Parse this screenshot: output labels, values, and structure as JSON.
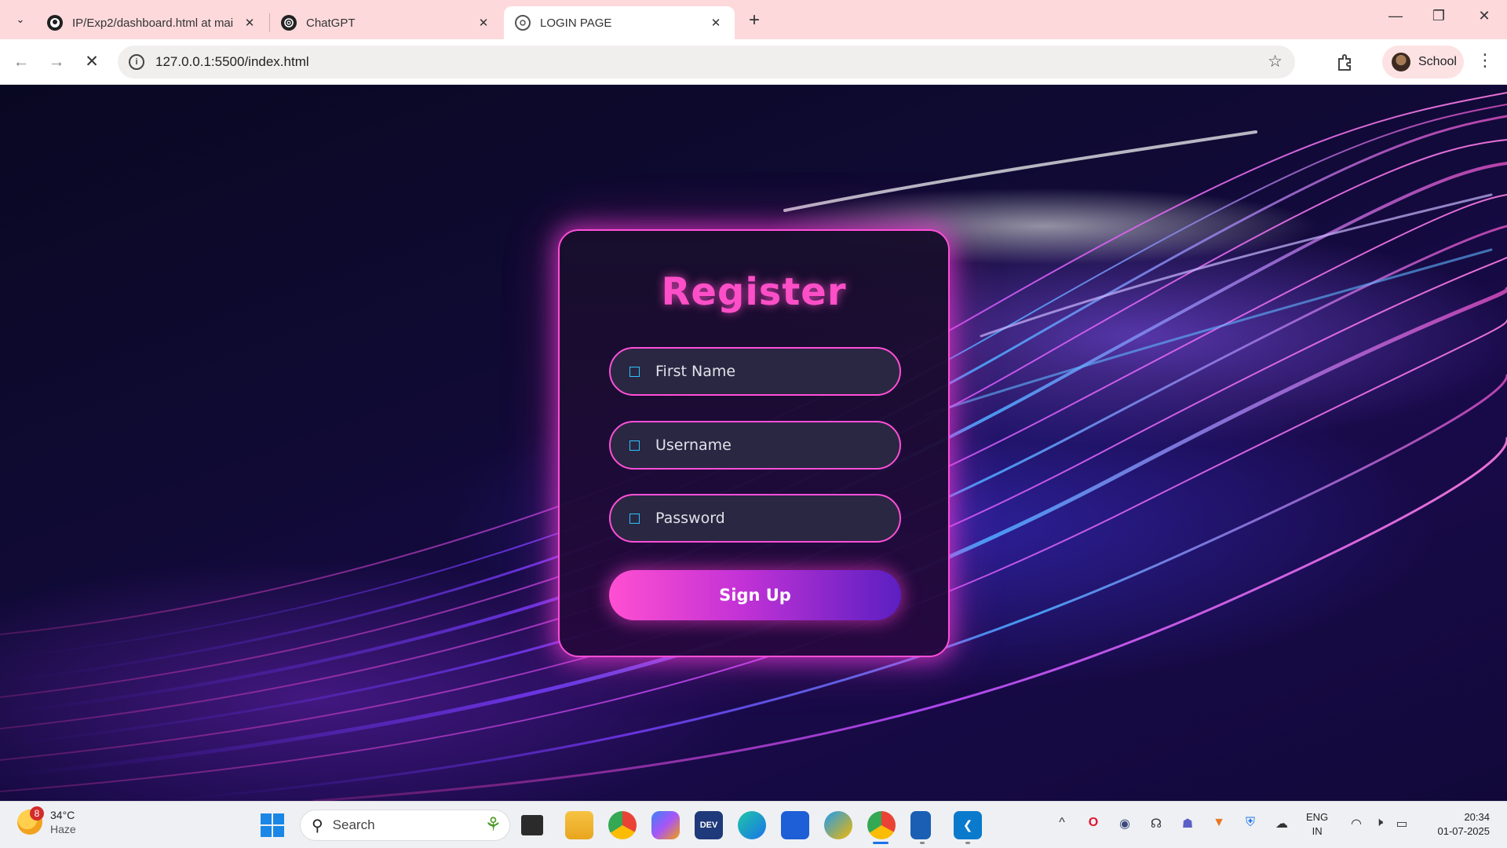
{
  "browser": {
    "tabs": [
      {
        "title": "IP/Exp2/dashboard.html at mai",
        "icon": "github-icon"
      },
      {
        "title": "ChatGPT",
        "icon": "chatgpt-icon"
      },
      {
        "title": "LOGIN PAGE",
        "icon": "page-favicon-icon",
        "active": true
      }
    ],
    "url": "127.0.0.1:5500/index.html",
    "profile_label": "School"
  },
  "form": {
    "title": "Register",
    "fields": [
      {
        "placeholder": "First Name"
      },
      {
        "placeholder": "Username"
      },
      {
        "placeholder": "Password"
      }
    ],
    "submit_label": "Sign Up"
  },
  "taskbar": {
    "weather": {
      "temp": "34°C",
      "condition": "Haze",
      "badge": "8"
    },
    "search_placeholder": "Search",
    "lang": {
      "line1": "ENG",
      "line2": "IN"
    },
    "time": "20:34",
    "date": "01-07-2025"
  },
  "colors": {
    "accent_pink": "#ff4fd8",
    "title_pink": "#ff4fc8",
    "field_icon_blue": "#2cc3ff",
    "tabbar_bg": "#fdd9dc"
  }
}
